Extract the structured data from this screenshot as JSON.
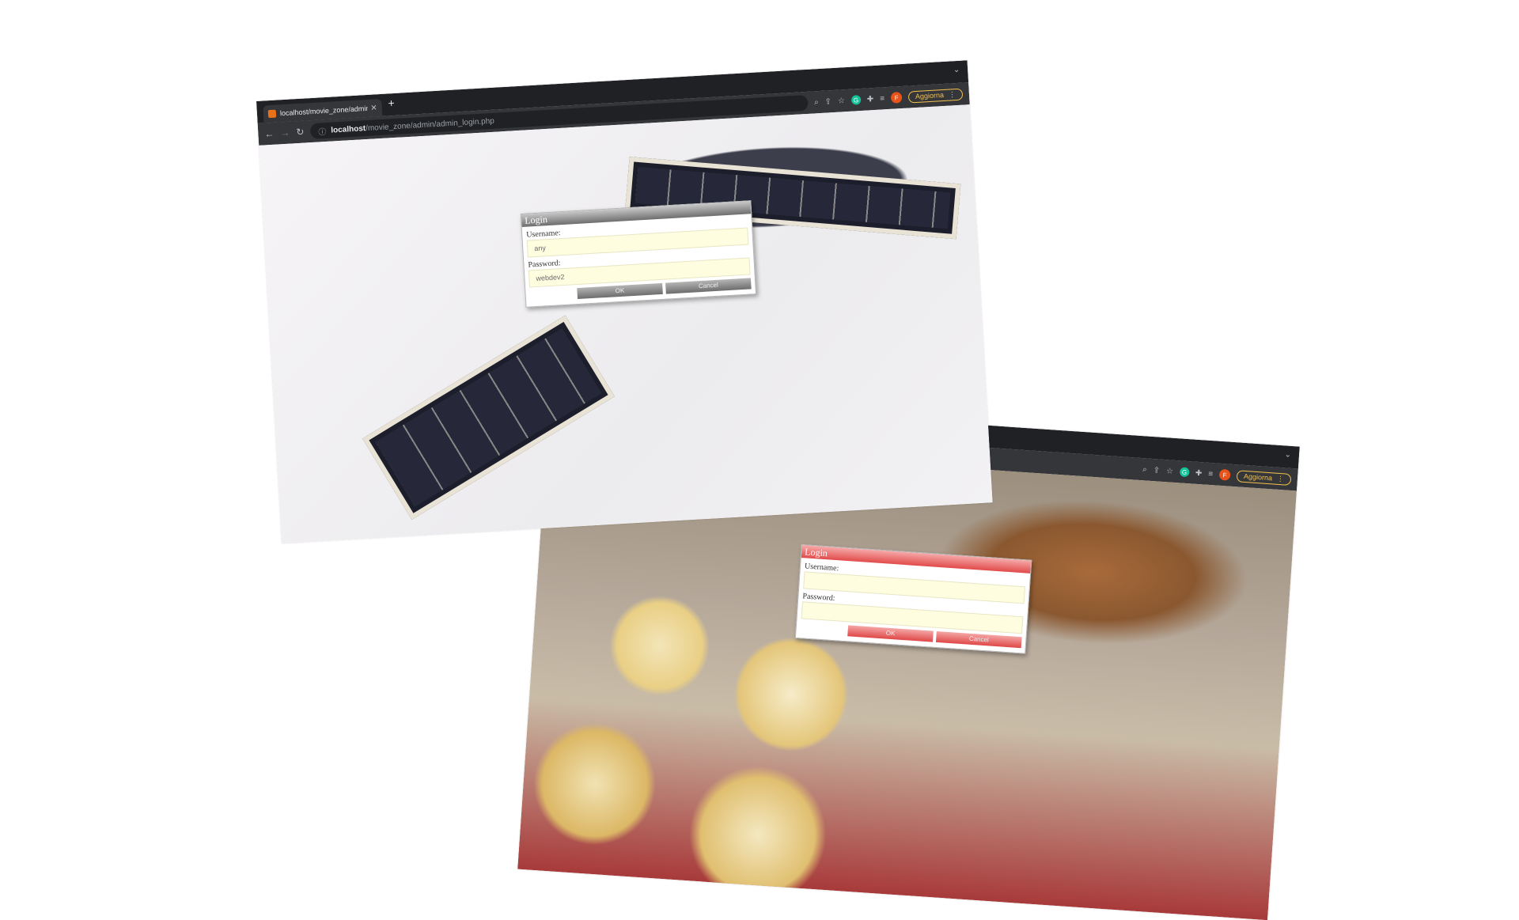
{
  "screenshots": [
    {
      "theme": "film",
      "tab": {
        "title": "localhost/movie_zone/admin/a"
      },
      "address": {
        "host": "localhost",
        "path": "/movie_zone/admin/admin_login.php"
      },
      "profile_initial": "F",
      "update_label": "Aggiorna",
      "dialog": {
        "title": "Login",
        "username_label": "Username:",
        "username_value": "any",
        "password_label": "Password:",
        "password_value": "webdev2",
        "ok_label": "OK",
        "cancel_label": "Cancel"
      }
    },
    {
      "theme": "popcorn",
      "profile_initial": "F",
      "update_label": "Aggiorna",
      "dialog": {
        "title": "Login",
        "username_label": "Username:",
        "username_value": "",
        "password_label": "Password:",
        "password_value": "",
        "ok_label": "OK",
        "cancel_label": "Cancel"
      }
    }
  ],
  "colors": {
    "chrome_dark": "#202124",
    "dialog_title_gray": "#6e6e6e",
    "dialog_title_red": "#e24b4b",
    "input_bg": "#fffde0",
    "update_accent": "#f2c14e"
  },
  "icons": [
    "favicon-icon",
    "close-tab-icon",
    "new-tab-icon",
    "back-icon",
    "forward-icon",
    "reload-icon",
    "info-icon",
    "zoom-icon",
    "share-icon",
    "star-icon",
    "grammarly-icon",
    "extensions-icon",
    "reading-list-icon",
    "menu-icon",
    "chevron-down-icon"
  ]
}
